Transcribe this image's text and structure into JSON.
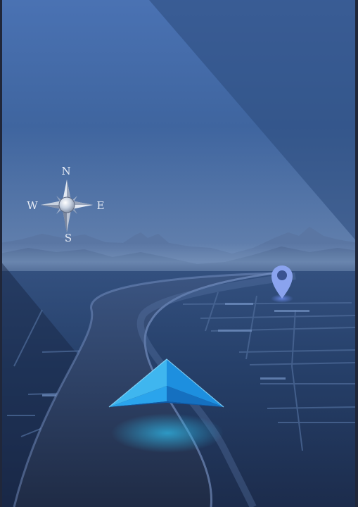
{
  "scene": {
    "colors": {
      "sky_top": "#4a72b3",
      "sky_mid": "#385a8e",
      "horizon": "#6a8bb6",
      "ground": "#27406a",
      "ground_dark": "#18243d",
      "road": "#25334f",
      "arrow_light": "#4ac0f0",
      "arrow_dark": "#1f8ee0",
      "pin": "#8aa3ee"
    }
  },
  "compass": {
    "icon": "compass-rose-icon",
    "north": "N",
    "south": "S",
    "east": "E",
    "west": "W"
  },
  "location_pin": {
    "icon": "map-pin-icon"
  },
  "nav_arrow": {
    "icon": "navigation-arrow-icon"
  }
}
